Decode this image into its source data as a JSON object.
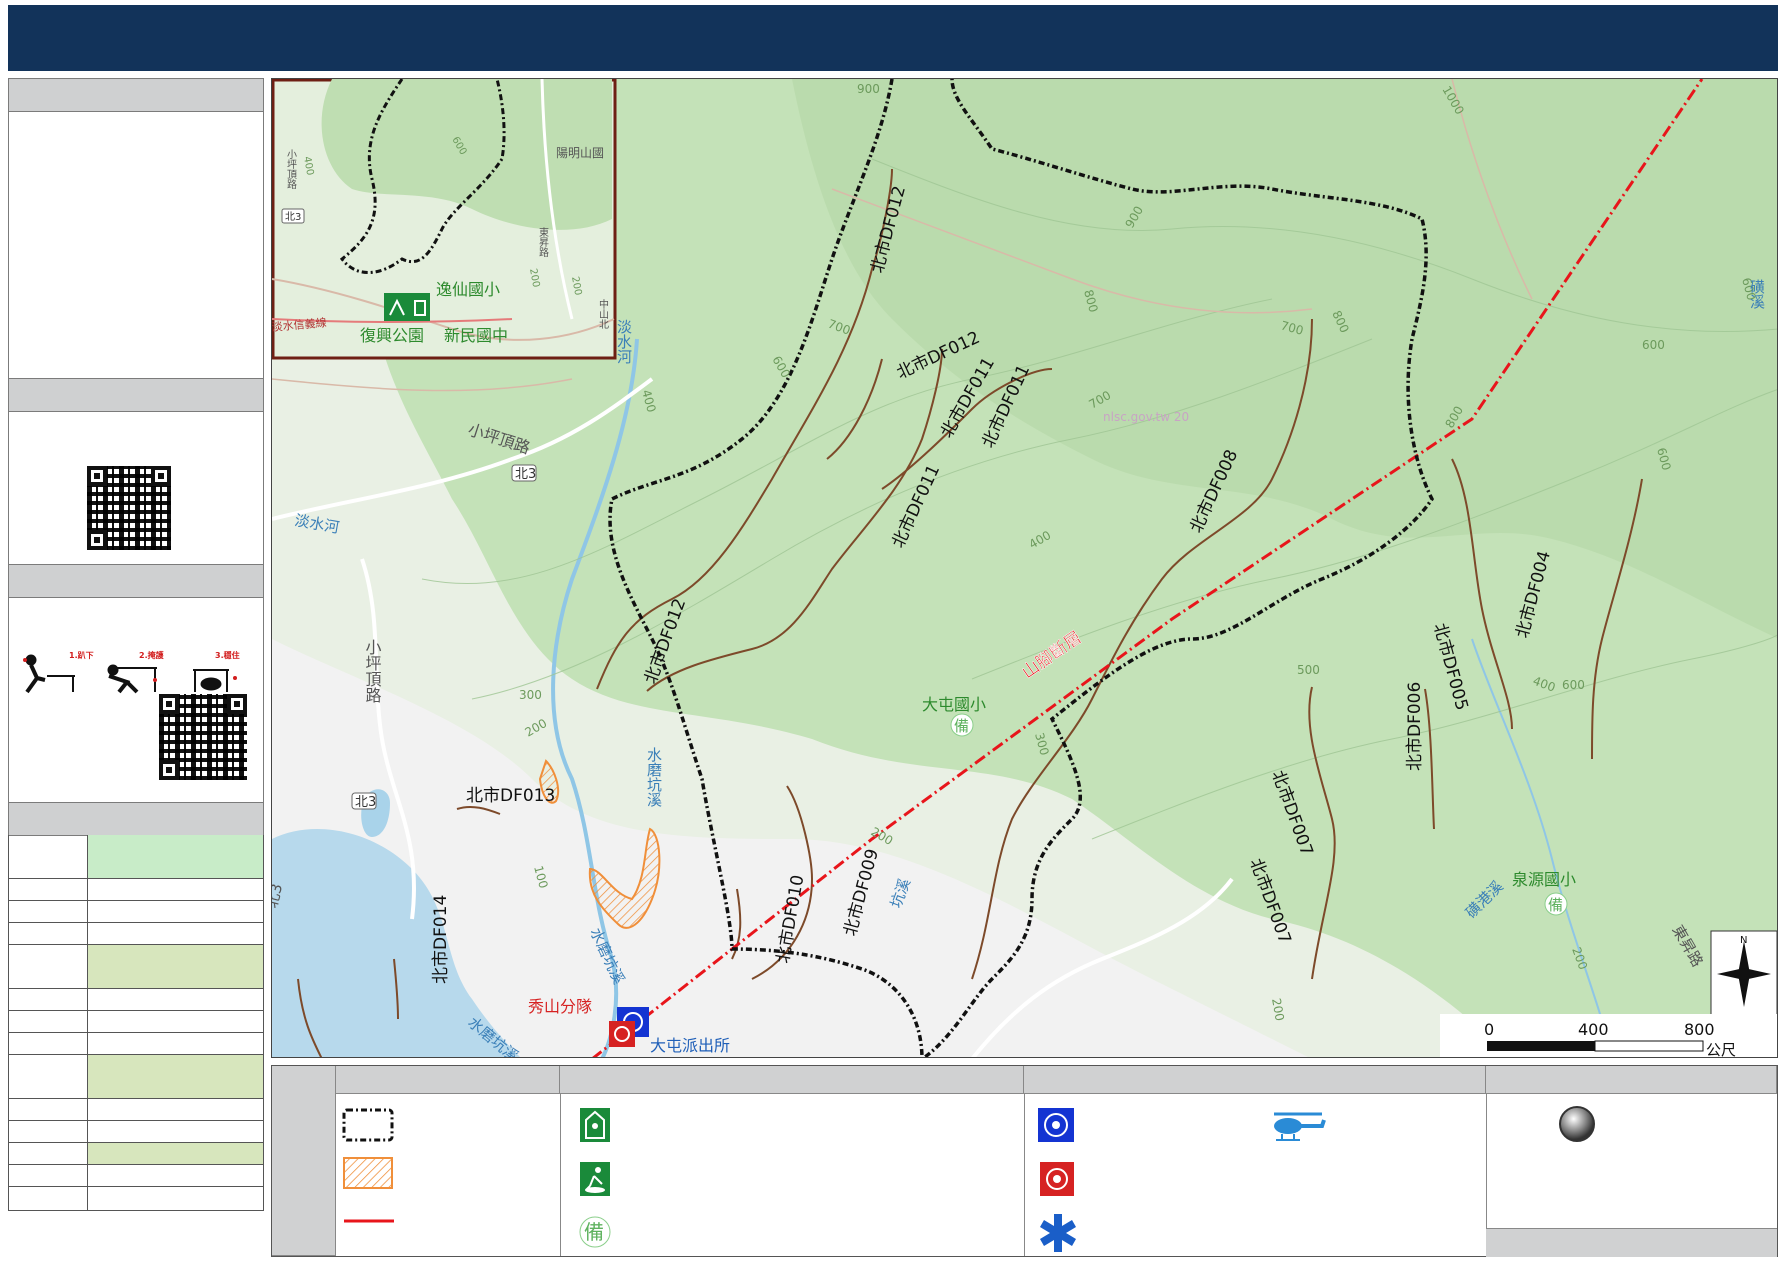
{
  "map": {
    "road_labels": [
      "小坪頂路",
      "小坪頂路",
      "北3",
      "北3",
      "北3",
      "東昇路",
      "東昇路",
      "中山北",
      "淡水信義線"
    ],
    "river_labels": [
      "淡水河",
      "淡水河",
      "水磨坑溪",
      "水磨坑溪",
      "水磨坑溪",
      "磺港溪",
      "磺溪",
      "坑溪"
    ],
    "fault_label": "山腳斷層",
    "debris_flow_labels": [
      "北市DF012",
      "北市DF012",
      "北市DF012",
      "北市DF011",
      "北市DF011",
      "北市DF011",
      "北市DF008",
      "北市DF004",
      "北市DF005",
      "北市DF006",
      "北市DF007",
      "北市DF007",
      "北市DF009",
      "北市DF010",
      "北市DF013",
      "北市DF014"
    ],
    "contour_labels": [
      "900",
      "900",
      "1000",
      "800",
      "800",
      "800",
      "700",
      "700",
      "700",
      "600",
      "600",
      "600",
      "600",
      "500",
      "400",
      "400",
      "300",
      "300",
      "200",
      "200",
      "200",
      "100",
      "400",
      "600",
      "200"
    ],
    "school_labels": [
      "大屯國小",
      "泉源國小"
    ],
    "reserve_mark": "備",
    "police_labels": [
      "秀山分隊",
      "大屯派出所"
    ],
    "watermark": "nlsc.gov.tw 20",
    "inset": {
      "labels": [
        "逸仙國小",
        "復興公園",
        "新民國中",
        "陽明山國",
        "淡水信義線",
        "北3",
        "東昇路",
        "中山北",
        "小坪頂路"
      ],
      "contours": [
        "600",
        "400",
        "200",
        "200"
      ]
    },
    "north_arrow": "N",
    "scale": {
      "ticks": [
        "0",
        "400",
        "800"
      ],
      "unit": "公尺"
    }
  },
  "colors": {
    "header": "#12335a",
    "forest": "#c4e2b8",
    "boundary": "#000000",
    "debris_stream": "#7d4a2a",
    "fault": "#e8151b",
    "landslide": "#f08f3a",
    "shelter_green": "#1a8a3a",
    "police_blue": "#1434d2",
    "fire_red": "#d62222"
  },
  "sidebar": {
    "earthquake_steps": [
      "1.趴下",
      "2.掩護",
      "3.穩住"
    ]
  },
  "legend": {
    "icons": [
      "boundary-icon",
      "landslide-icon",
      "fault-line-icon",
      "shelter-indoor-icon",
      "shelter-outdoor-icon",
      "reserve-shelter-icon",
      "police-icon",
      "fire-station-icon",
      "medical-icon",
      "helicopter-icon",
      "location-point-icon"
    ],
    "reserve_mark": "備"
  }
}
